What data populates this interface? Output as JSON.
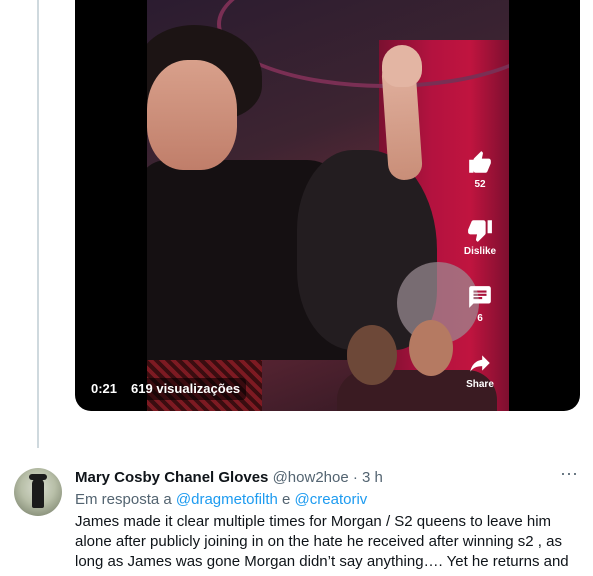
{
  "video": {
    "elapsed": "0:21",
    "views": "619 visualizações",
    "actions": [
      {
        "icon": "thumbs-up-icon",
        "label": "52"
      },
      {
        "icon": "thumbs-down-icon",
        "label": "Dislike"
      },
      {
        "icon": "comment-icon",
        "label": "6"
      },
      {
        "icon": "share-icon",
        "label": "Share"
      }
    ]
  },
  "reply": {
    "author_name": "Mary Cosby Chanel Gloves",
    "author_handle": "@how2hoe",
    "separator": "·",
    "time": "3 h",
    "replying_prefix": "Em resposta a",
    "replying_user1": "@dragmetofilth",
    "replying_conj": "e",
    "replying_user2": "@creatoriv",
    "text": "James made it clear multiple times for Morgan / S2 queens to leave him alone after publicly joining in on the hate he received after winning s2 , as long as James was gone Morgan didn’t say anything…. Yet he returns and",
    "more_icon": "more-horizontal-icon"
  },
  "colors": {
    "link": "#1d9bf0",
    "muted": "#536471",
    "text": "#0f1419",
    "thread_line": "#cfd9de"
  }
}
